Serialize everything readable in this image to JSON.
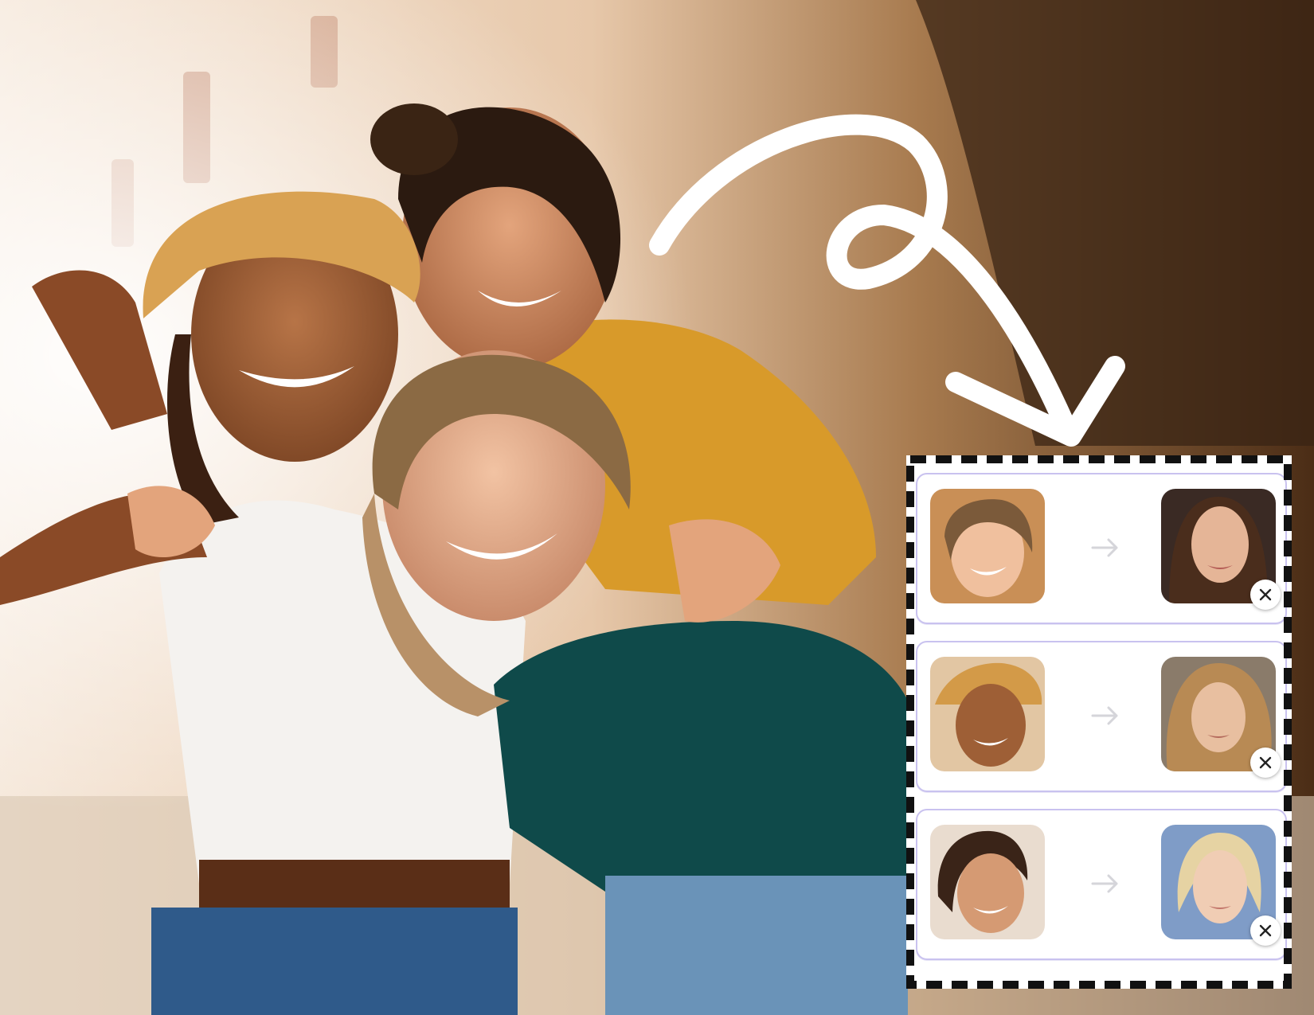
{
  "scene": {
    "icons": {
      "decoration": "loop-arrow-icon"
    }
  },
  "swaps": [
    {
      "source_icon": "face-photo",
      "target_icon": "face-photo",
      "arrow_icon": "arrow-right-icon",
      "remove_icon": "close-icon"
    },
    {
      "source_icon": "face-photo",
      "target_icon": "face-photo",
      "arrow_icon": "arrow-right-icon",
      "remove_icon": "close-icon"
    },
    {
      "source_icon": "face-photo",
      "target_icon": "face-photo",
      "arrow_icon": "arrow-right-icon",
      "remove_icon": "close-icon"
    }
  ],
  "colors": {
    "panel_border": "#c9c2ef",
    "arrow": "#d5d5da",
    "frame_dash": "#111111"
  }
}
